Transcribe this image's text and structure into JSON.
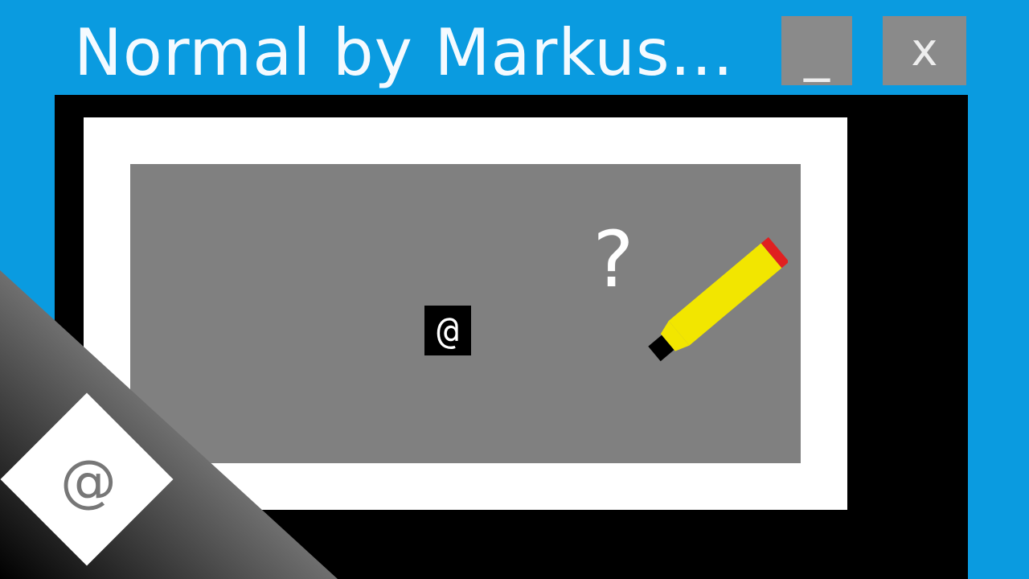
{
  "window": {
    "title": "Normal by Markus...",
    "minimize_label": "_",
    "close_label": "x"
  },
  "canvas": {
    "cursor_glyph": "@",
    "help_glyph": "?",
    "pencil_icon": "pencil-icon"
  },
  "badge": {
    "glyph": "@"
  },
  "colors": {
    "desktop": "#0a9be0",
    "window_body": "#000000",
    "frame": "#ffffff",
    "canvas": "#808080",
    "title_buttons": "#8a8a8a",
    "pencil_body": "#f2e600",
    "pencil_eraser": "#e02020"
  }
}
